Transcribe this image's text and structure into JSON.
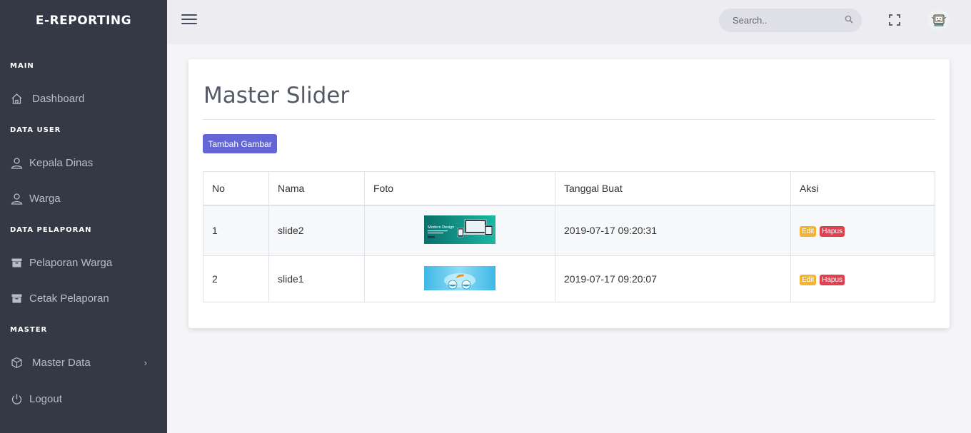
{
  "brand": "E-REPORTING",
  "sidebar": {
    "sections": [
      "MAIN",
      "DATA USER",
      "DATA PELAPORAN",
      "MASTER"
    ],
    "items": [
      {
        "label": "Dashboard",
        "icon": "home-icon"
      },
      {
        "label": "Kepala Dinas",
        "icon": "user-icon"
      },
      {
        "label": "Warga",
        "icon": "user-icon"
      },
      {
        "label": "Pelaporan Warga",
        "icon": "archive-icon"
      },
      {
        "label": "Cetak Pelaporan",
        "icon": "archive-icon"
      },
      {
        "label": "Master Data",
        "icon": "box-icon",
        "has_submenu": true
      },
      {
        "label": "Logout",
        "icon": "power-icon"
      }
    ]
  },
  "topbar": {
    "search_placeholder": "Search..",
    "icons": [
      "menu-icon",
      "search-icon",
      "fullscreen-icon",
      "avatar"
    ]
  },
  "main": {
    "title": "Master Slider",
    "add_button": "Tambah Gambar",
    "table": {
      "columns": [
        "No",
        "Nama",
        "Foto",
        "Tanggal Buat",
        "Aksi"
      ],
      "rows": [
        {
          "no": "1",
          "nama": "slide2",
          "foto_text": "Modern Design",
          "tanggal": "2019-07-17 09:20:31",
          "edit": "Edit",
          "hapus": "Hapus"
        },
        {
          "no": "2",
          "nama": "slide1",
          "foto_text": "",
          "tanggal": "2019-07-17 09:20:07",
          "edit": "Edit",
          "hapus": "Hapus"
        }
      ]
    }
  },
  "colors": {
    "sidebar_bg": "#353946",
    "primary_button": "#6566d6",
    "edit_badge": "#f6b42e",
    "delete_badge": "#e2404f"
  }
}
